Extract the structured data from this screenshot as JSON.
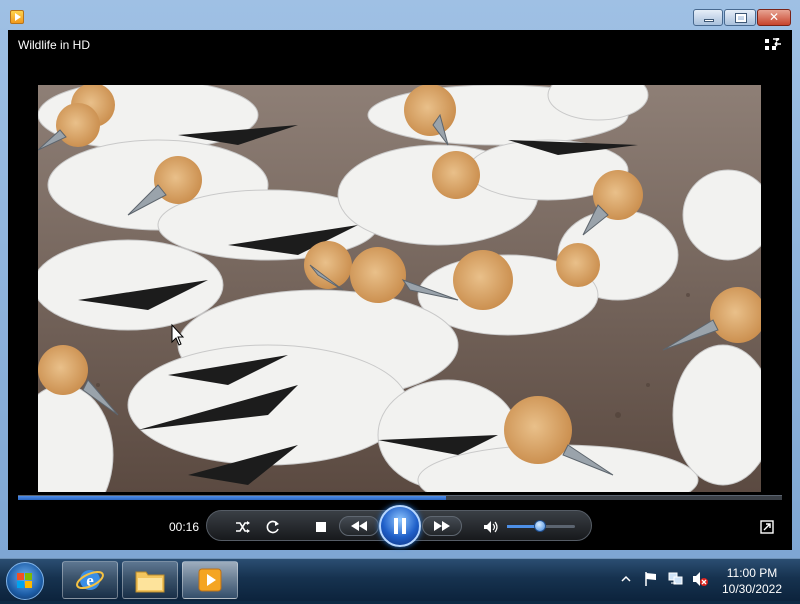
{
  "window": {
    "title": "Wildlife in HD",
    "controls": [
      "minimize",
      "maximize",
      "close"
    ],
    "close_glyph": "✕"
  },
  "player": {
    "current_time": "00:16",
    "seek_progress_percent": 56,
    "volume_percent": 48,
    "state": "playing",
    "controls": [
      "shuffle",
      "repeat",
      "stop",
      "previous",
      "play-pause",
      "next",
      "mute",
      "volume-slider"
    ],
    "accent_color": "#2b67c4"
  },
  "taskbar": {
    "pinned": [
      "start-orb",
      "internet-explorer",
      "windows-explorer",
      "windows-media-player"
    ],
    "tray_icons": [
      "show-hidden-icons",
      "action-center-flag",
      "network",
      "volume-muted"
    ],
    "clock_time": "11:00 PM",
    "clock_date": "10/30/2022"
  }
}
